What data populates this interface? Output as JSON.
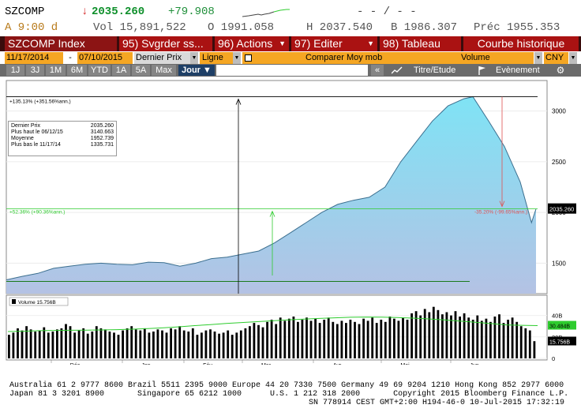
{
  "ticker": {
    "symbol": "SZCOMP",
    "arrow": "↓",
    "last": "2035.260",
    "change": "+79.908",
    "sparkline_dashes": "- - / - -",
    "time_label": "A 9:00 d",
    "vol": "Vol 15,891,522",
    "open": "O 1991.058",
    "high": "H 2037.540",
    "low": "B 1986.307",
    "prev": "Préc  1955.353"
  },
  "toolbar": {
    "index_label": "SZCOMP Index",
    "save_label": "95) Svgrder ss...",
    "actions_label": "96) Actions",
    "edit_label": "97) Editer",
    "table_label": "98) Tableau",
    "title_label": "Courbe historique"
  },
  "controls": {
    "start_date": "11/17/2014",
    "dash": "-",
    "end_date": "07/10/2015",
    "field": "Dernier Prix",
    "style": "Ligne",
    "compare": "Comparer Moy mob",
    "volume": "Volume",
    "currency": "CNY"
  },
  "periods": [
    "1J",
    "3J",
    "1M",
    "6M",
    "YTD",
    "1A",
    "5A",
    "Max"
  ],
  "frequency": "Jour ▼",
  "right_controls": {
    "collapse": "«",
    "study": "Titre/Etude",
    "event": "Evènement"
  },
  "legend": {
    "rows": [
      {
        "label": "Dernier Prix",
        "value": "2035.260"
      },
      {
        "label": "Plus haut le 06/12/15",
        "value": "3140.663"
      },
      {
        "label": "Moyenne",
        "value": "1952.739"
      },
      {
        "label": "Plus bas le 11/17/14",
        "value": "1335.731"
      }
    ]
  },
  "annotations": {
    "top_line": "+135.13% (+351.56%ann.)",
    "mid_line": "+52.36% (+90.36%ann.)",
    "drop": "-35.20% (-99.65%ann.)",
    "last_price_tag": "2035.260"
  },
  "volume_panel": {
    "legend": "Volume 15.756B",
    "tag_ma": "30.484B",
    "tag_vol": "15.756B"
  },
  "footer": {
    "line1": "Australia 61 2 9777 8600 Brazil 5511 2395 9000 Europe 44 20 7330 7500 Germany 49 69 9204 1210 Hong Kong 852 2977 6000",
    "line2": "Japan 81 3 3201 8900       Singapore 65 6212 1000      U.S. 1 212 318 2000       Copyright 2015 Bloomberg Finance L.P.",
    "line3": "SN 778914 CEST GMT+2:00 H194-46-0 10-Jul-2015 17:32:19"
  },
  "colors": {
    "area_top": "#7fe3f5",
    "area_bottom": "#b4c2e4",
    "ma_line": "#2ecc2e",
    "red_annot": "#e05050"
  },
  "chart_data": {
    "type": "area",
    "title": "",
    "x": [
      "2014-11-17",
      "2014-11-24",
      "2014-12-01",
      "2014-12-08",
      "2014-12-15",
      "2014-12-22",
      "2014-12-29",
      "2015-01-05",
      "2015-01-12",
      "2015-01-19",
      "2015-01-26",
      "2015-02-02",
      "2015-02-09",
      "2015-02-16",
      "2015-02-23",
      "2015-03-02",
      "2015-03-09",
      "2015-03-16",
      "2015-03-23",
      "2015-03-30",
      "2015-04-06",
      "2015-04-13",
      "2015-04-20",
      "2015-04-27",
      "2015-05-04",
      "2015-05-11",
      "2015-05-18",
      "2015-05-25",
      "2015-06-01",
      "2015-06-08",
      "2015-06-12",
      "2015-06-19",
      "2015-06-26",
      "2015-07-03",
      "2015-07-08",
      "2015-07-10"
    ],
    "y": [
      1336,
      1370,
      1400,
      1450,
      1470,
      1490,
      1500,
      1490,
      1485,
      1510,
      1505,
      1470,
      1500,
      1545,
      1560,
      1590,
      1620,
      1700,
      1800,
      1900,
      2000,
      2080,
      2120,
      2150,
      2250,
      2500,
      2700,
      2900,
      3050,
      3120,
      3140,
      2900,
      2650,
      2300,
      1900,
      2035
    ],
    "ylim": [
      1200,
      3300
    ],
    "yticks": [
      1500,
      2000,
      2500,
      3000
    ],
    "xtick_labels": [
      "Déc",
      "Jan",
      "Fév",
      "Mar",
      "Avr",
      "Mai",
      "Jun"
    ],
    "year_labels": [
      "2014",
      "2015"
    ],
    "volume": {
      "label": "Volume 15.756B",
      "yticks": [
        "0",
        "20B",
        "40B"
      ],
      "ylim": [
        0,
        50
      ],
      "values": [
        22,
        24,
        28,
        26,
        30,
        27,
        25,
        26,
        29,
        24,
        25,
        27,
        28,
        32,
        30,
        24,
        26,
        28,
        23,
        25,
        30,
        28,
        27,
        25,
        24,
        22,
        26,
        28,
        30,
        27,
        26,
        28,
        24,
        25,
        27,
        26,
        24,
        28,
        27,
        30,
        26,
        25,
        28,
        22,
        24,
        26,
        27,
        25,
        23,
        24,
        26,
        22,
        24,
        26,
        28,
        30,
        33,
        31,
        29,
        34,
        36,
        32,
        38,
        35,
        37,
        39,
        34,
        36,
        38,
        35,
        37,
        33,
        36,
        38,
        34,
        32,
        35,
        33,
        36,
        34,
        32,
        37,
        35,
        38,
        33,
        36,
        34,
        39,
        37,
        35,
        38,
        36,
        42,
        44,
        40,
        46,
        43,
        48,
        45,
        41,
        43,
        40,
        44,
        39,
        42,
        38,
        36,
        40,
        35,
        37,
        34,
        39,
        41,
        33,
        36,
        38,
        34,
        30,
        28,
        26,
        16
      ],
      "ma": [
        25,
        25.3,
        25.8,
        26,
        26.2,
        26.3,
        26.5,
        26.8,
        27.2,
        27.8,
        28.5,
        29.4,
        30.5,
        31.5,
        32.5,
        33.4,
        34.2,
        35,
        35.8,
        36.6,
        37.2,
        37.8,
        38.3,
        38.5,
        38.4,
        38,
        37.5,
        36.8,
        35.8,
        34.8,
        33.6,
        32.4,
        31.2,
        30.8,
        30.5
      ]
    }
  }
}
